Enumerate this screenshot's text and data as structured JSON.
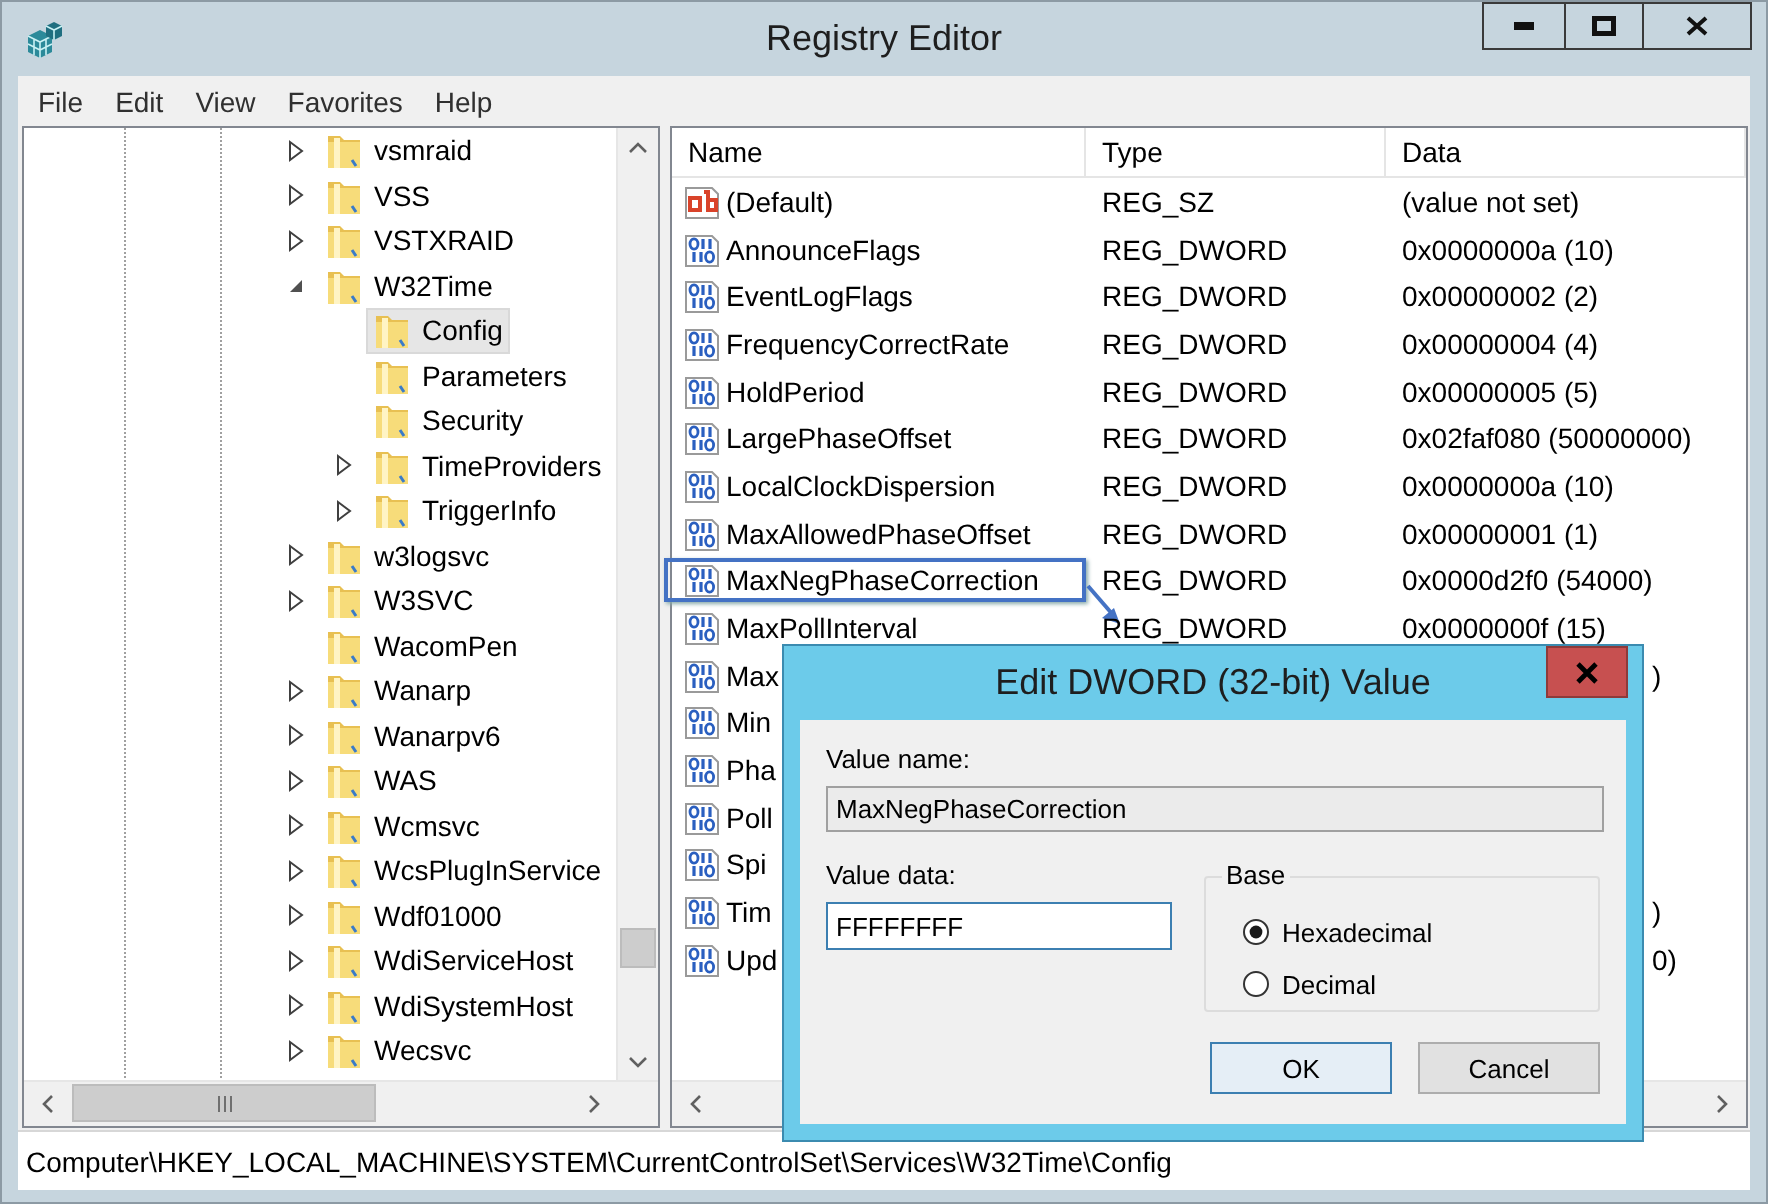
{
  "window": {
    "title": "Registry Editor"
  },
  "menu": [
    {
      "label": "File"
    },
    {
      "label": "Edit"
    },
    {
      "label": "View"
    },
    {
      "label": "Favorites"
    },
    {
      "label": "Help"
    }
  ],
  "tree": [
    {
      "label": "vsmraid",
      "expanded": false,
      "selected": false
    },
    {
      "label": "VSS",
      "expanded": false,
      "selected": false
    },
    {
      "label": "VSTXRAID",
      "expanded": false,
      "selected": false
    },
    {
      "label": "W32Time",
      "expanded": true,
      "selected": false,
      "children": [
        {
          "label": "Config",
          "selected": true
        },
        {
          "label": "Parameters",
          "selected": false
        },
        {
          "label": "Security",
          "selected": false
        },
        {
          "label": "TimeProviders",
          "expanded": false,
          "selected": false
        },
        {
          "label": "TriggerInfo",
          "expanded": false,
          "selected": false
        }
      ]
    },
    {
      "label": "w3logsvc",
      "expanded": false,
      "selected": false
    },
    {
      "label": "W3SVC",
      "expanded": false,
      "selected": false
    },
    {
      "label": "WacomPen",
      "selected": false
    },
    {
      "label": "Wanarp",
      "expanded": false,
      "selected": false
    },
    {
      "label": "Wanarpv6",
      "expanded": false,
      "selected": false
    },
    {
      "label": "WAS",
      "expanded": false,
      "selected": false
    },
    {
      "label": "Wcmsvc",
      "expanded": false,
      "selected": false
    },
    {
      "label": "WcsPlugInService",
      "expanded": false,
      "selected": false
    },
    {
      "label": "Wdf01000",
      "expanded": false,
      "selected": false
    },
    {
      "label": "WdiServiceHost",
      "expanded": false,
      "selected": false
    },
    {
      "label": "WdiSystemHost",
      "expanded": false,
      "selected": false
    },
    {
      "label": "Wecsvc",
      "expanded": false,
      "selected": false
    }
  ],
  "table": {
    "columns": [
      "Name",
      "Type",
      "Data"
    ],
    "rows": [
      {
        "kind": "string",
        "name": "(Default)",
        "type": "REG_SZ",
        "data": "(value not set)",
        "highlighted": false
      },
      {
        "kind": "dword",
        "name": "AnnounceFlags",
        "type": "REG_DWORD",
        "data": "0x0000000a (10)",
        "highlighted": false
      },
      {
        "kind": "dword",
        "name": "EventLogFlags",
        "type": "REG_DWORD",
        "data": "0x00000002 (2)",
        "highlighted": false
      },
      {
        "kind": "dword",
        "name": "FrequencyCorrectRate",
        "type": "REG_DWORD",
        "data": "0x00000004 (4)",
        "highlighted": false
      },
      {
        "kind": "dword",
        "name": "HoldPeriod",
        "type": "REG_DWORD",
        "data": "0x00000005 (5)",
        "highlighted": false
      },
      {
        "kind": "dword",
        "name": "LargePhaseOffset",
        "type": "REG_DWORD",
        "data": "0x02faf080 (50000000)",
        "highlighted": false
      },
      {
        "kind": "dword",
        "name": "LocalClockDispersion",
        "type": "REG_DWORD",
        "data": "0x0000000a (10)",
        "highlighted": false
      },
      {
        "kind": "dword",
        "name": "MaxAllowedPhaseOffset",
        "type": "REG_DWORD",
        "data": "0x00000001 (1)",
        "highlighted": false
      },
      {
        "kind": "dword",
        "name": "MaxNegPhaseCorrection",
        "type": "REG_DWORD",
        "data": "0x0000d2f0 (54000)",
        "highlighted": true
      },
      {
        "kind": "dword",
        "name": "MaxPollInterval",
        "type": "REG_DWORD",
        "data": "0x0000000f (15)",
        "highlighted": false
      },
      {
        "kind": "dword",
        "name": "Max",
        "data_tail": ")",
        "highlighted": false
      },
      {
        "kind": "dword",
        "name": "Min",
        "highlighted": false
      },
      {
        "kind": "dword",
        "name": "Pha",
        "highlighted": false
      },
      {
        "kind": "dword",
        "name": "Poll",
        "highlighted": false
      },
      {
        "kind": "dword",
        "name": "Spi",
        "highlighted": false
      },
      {
        "kind": "dword",
        "name": "Tim",
        "data_tail": ")",
        "highlighted": false
      },
      {
        "kind": "dword",
        "name": "Upd",
        "data_tail": "0)",
        "highlighted": false
      }
    ]
  },
  "status_bar": "Computer\\HKEY_LOCAL_MACHINE\\SYSTEM\\CurrentControlSet\\Services\\W32Time\\Config",
  "dialog": {
    "title": "Edit DWORD (32-bit) Value",
    "value_name_label": "Value name:",
    "value_name": "MaxNegPhaseCorrection",
    "value_data_label": "Value data:",
    "value_data": "FFFFFFFF",
    "base_label": "Base",
    "base_options": [
      {
        "label": "Hexadecimal",
        "selected": true
      },
      {
        "label": "Decimal",
        "selected": false
      }
    ],
    "buttons": [
      {
        "label": "OK",
        "default": true
      },
      {
        "label": "Cancel",
        "default": false
      }
    ]
  }
}
